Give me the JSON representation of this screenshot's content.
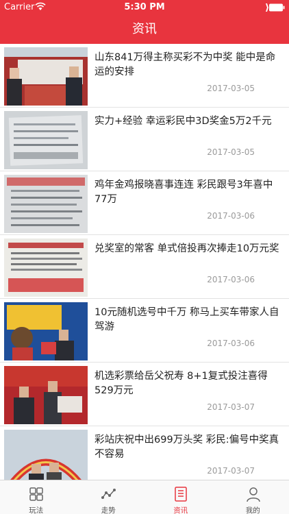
{
  "status_bar": {
    "carrier": "Carrier",
    "time": "5:30 PM"
  },
  "nav": {
    "title": "资讯"
  },
  "colors": {
    "accent": "#e8343e",
    "date_text": "#9a9a9a",
    "tab_inactive": "#555555"
  },
  "news": [
    {
      "title": "山东841万得主称买彩不为中奖 能中是命运的安排",
      "date": "2017-03-05",
      "thumb": "photo-winners-with-check"
    },
    {
      "title": "实力+经验 幸运彩民中3D奖金5万2千元",
      "date": "2017-03-05",
      "thumb": "photo-lottery-ticket"
    },
    {
      "title": "鸡年金鸡报晓喜事连连 彩民跟号3年喜中77万",
      "date": "2017-03-06",
      "thumb": "photo-lottery-ticket"
    },
    {
      "title": "兑奖室的常客 单式倍投再次捧走10万元奖",
      "date": "2017-03-06",
      "thumb": "photo-lottery-ticket-red-stamp"
    },
    {
      "title": "10元随机选号中千万 称马上买车带家人自驾游",
      "date": "2017-03-06",
      "thumb": "photo-winner-with-mascot"
    },
    {
      "title": "机选彩票给岳父祝寿 8+1复式投注喜得529万元",
      "date": "2017-03-07",
      "thumb": "photo-winners-with-check"
    },
    {
      "title": "彩站庆祝中出699万头奖 彩民:偏号中奖真不容易",
      "date": "2017-03-07",
      "thumb": "photo-celebration-arch"
    }
  ],
  "tabs": [
    {
      "label": "玩法",
      "icon": "grid-icon",
      "active": false
    },
    {
      "label": "走势",
      "icon": "trend-line-icon",
      "active": false
    },
    {
      "label": "资讯",
      "icon": "news-list-icon",
      "active": true
    },
    {
      "label": "我的",
      "icon": "person-icon",
      "active": false
    }
  ]
}
